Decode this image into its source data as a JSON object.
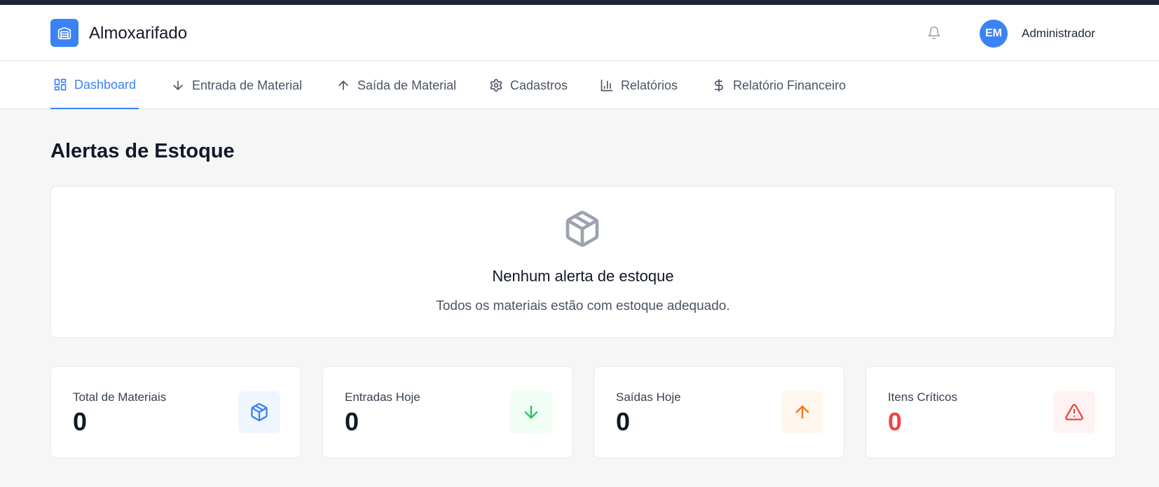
{
  "header": {
    "app_title": "Almoxarifado",
    "user_initials": "EM",
    "user_name": "Administrador"
  },
  "nav": {
    "tabs": [
      {
        "label": "Dashboard",
        "icon": "dashboard-grid-icon",
        "active": true
      },
      {
        "label": "Entrada de Material",
        "icon": "arrow-down-icon",
        "active": false
      },
      {
        "label": "Saída de Material",
        "icon": "arrow-up-icon",
        "active": false
      },
      {
        "label": "Cadastros",
        "icon": "gear-icon",
        "active": false
      },
      {
        "label": "Relatórios",
        "icon": "bar-chart-icon",
        "active": false
      },
      {
        "label": "Relatório Financeiro",
        "icon": "dollar-icon",
        "active": false
      }
    ]
  },
  "alerts": {
    "section_title": "Alertas de Estoque",
    "empty_title": "Nenhum alerta de estoque",
    "empty_description": "Todos os materiais estão com estoque adequado."
  },
  "stats": [
    {
      "label": "Total de Materiais",
      "value": "0",
      "icon": "box-icon",
      "accent": "#3b82f6"
    },
    {
      "label": "Entradas Hoje",
      "value": "0",
      "icon": "arrow-down-icon",
      "accent": "#22c55e"
    },
    {
      "label": "Saídas Hoje",
      "value": "0",
      "icon": "arrow-up-icon",
      "accent": "#f97316"
    },
    {
      "label": "Itens Críticos",
      "value": "0",
      "icon": "warning-icon",
      "accent": "#ef4444"
    }
  ],
  "colors": {
    "primary": "#3b82f6",
    "header_strip": "#1e2433",
    "background": "#f6f6f6"
  }
}
